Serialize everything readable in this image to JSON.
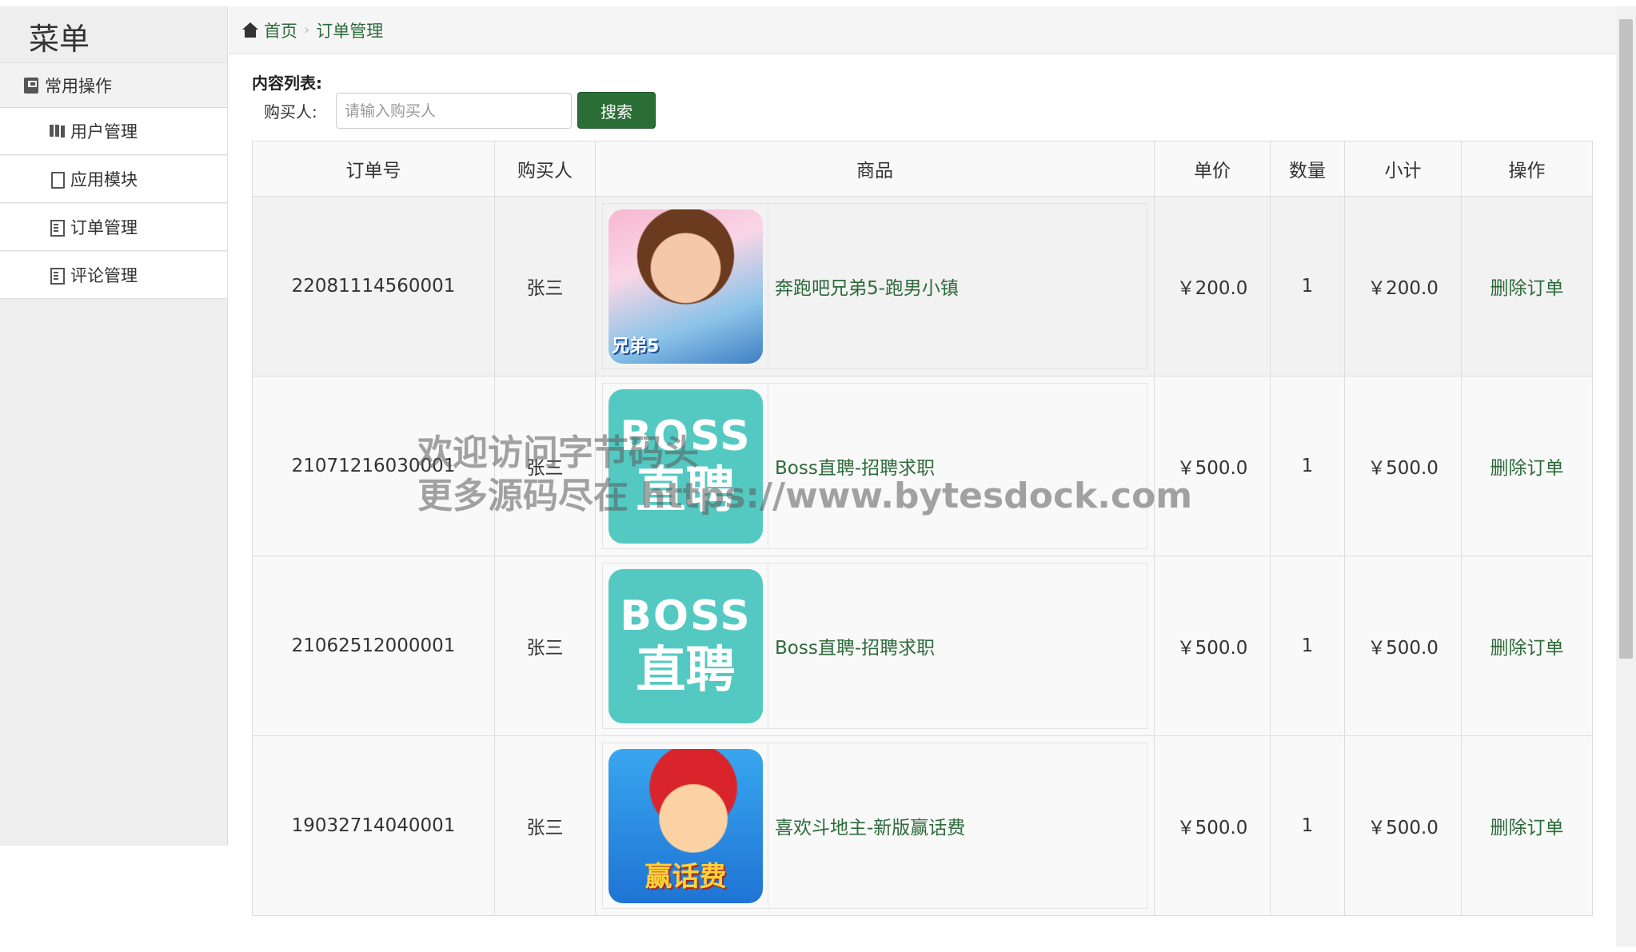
{
  "sidebar": {
    "title": "菜单",
    "group_label": "常用操作",
    "items": [
      {
        "label": "用户管理",
        "icon": "books-icon"
      },
      {
        "label": "应用模块",
        "icon": "file-icon"
      },
      {
        "label": "订单管理",
        "icon": "list-icon"
      },
      {
        "label": "评论管理",
        "icon": "list-icon"
      }
    ]
  },
  "breadcrumb": {
    "home": "首页",
    "current": "订单管理"
  },
  "content": {
    "list_label": "内容列表:",
    "buyer_label": "购买人:",
    "search_placeholder": "请输入购买人",
    "search_button": "搜索"
  },
  "table": {
    "headers": [
      "订单号",
      "购买人",
      "商品",
      "单价",
      "数量",
      "小计",
      "操作"
    ],
    "rows": [
      {
        "order_no": "22081114560001",
        "buyer": "张三",
        "product": "奔跑吧兄弟5-跑男小镇",
        "image": "star-poster",
        "price": "￥200.0",
        "qty": "1",
        "subtotal": "￥200.0",
        "action": "删除订单"
      },
      {
        "order_no": "21071216030001",
        "buyer": "张三",
        "product": "Boss直聘-招聘求职",
        "image": "boss-logo",
        "price": "￥500.0",
        "qty": "1",
        "subtotal": "￥500.0",
        "action": "删除订单"
      },
      {
        "order_no": "21062512000001",
        "buyer": "张三",
        "product": "Boss直聘-招聘求职",
        "image": "boss-logo",
        "price": "￥500.0",
        "qty": "1",
        "subtotal": "￥500.0",
        "action": "删除订单"
      },
      {
        "order_no": "19032714040001",
        "buyer": "张三",
        "product": "喜欢斗地主-新版赢话费",
        "image": "game-icon",
        "price": "￥500.0",
        "qty": "1",
        "subtotal": "￥500.0",
        "action": "删除订单"
      }
    ]
  },
  "image_text": {
    "star_caption": "兄弟5",
    "boss_line1": "BOSS",
    "boss_line2": "直聘",
    "game_caption": "赢话费"
  },
  "watermark": {
    "line1": "欢迎访问字节码头",
    "line2": "更多源码尽在 https://www.bytesdock.com"
  },
  "colors": {
    "accent": "#2d6a3a",
    "button": "#2a6e35",
    "sidebar_bg": "#eeeeee",
    "boss_teal": "#54c9c2"
  }
}
